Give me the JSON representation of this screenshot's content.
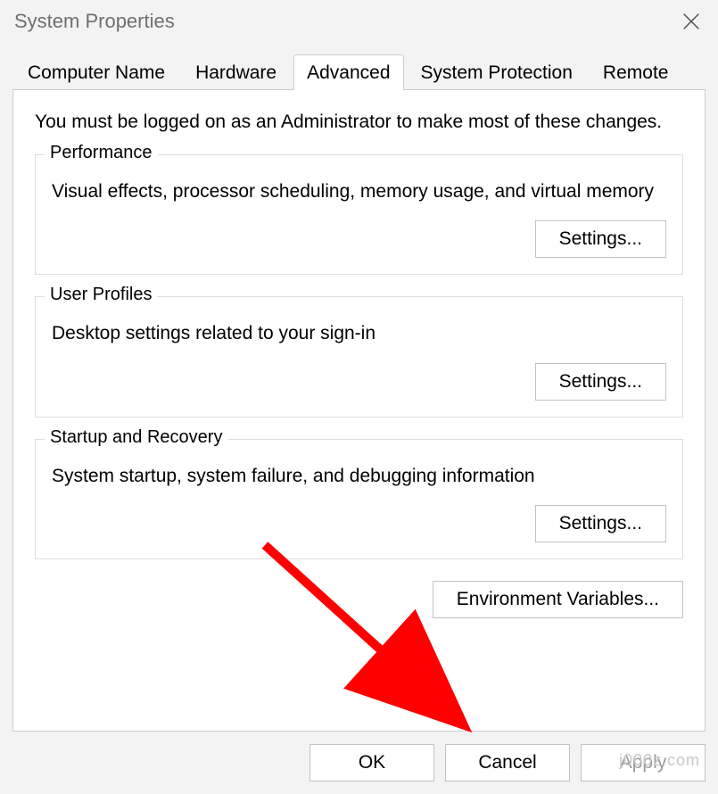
{
  "window": {
    "title": "System Properties"
  },
  "tabs": {
    "computer_name": "Computer Name",
    "hardware": "Hardware",
    "advanced": "Advanced",
    "system_protection": "System Protection",
    "remote": "Remote"
  },
  "panel": {
    "intro": "You must be logged on as an Administrator to make most of these changes.",
    "env_vars_button": "Environment Variables..."
  },
  "groups": {
    "performance": {
      "legend": "Performance",
      "desc": "Visual effects, processor scheduling, memory usage, and virtual memory",
      "button": "Settings..."
    },
    "user_profiles": {
      "legend": "User Profiles",
      "desc": "Desktop settings related to your sign-in",
      "button": "Settings..."
    },
    "startup": {
      "legend": "Startup and Recovery",
      "desc": "System startup, system failure, and debugging information",
      "button": "Settings..."
    }
  },
  "footer": {
    "ok": "OK",
    "cancel": "Cancel",
    "apply": "Apply"
  },
  "watermark": "j000z.com"
}
